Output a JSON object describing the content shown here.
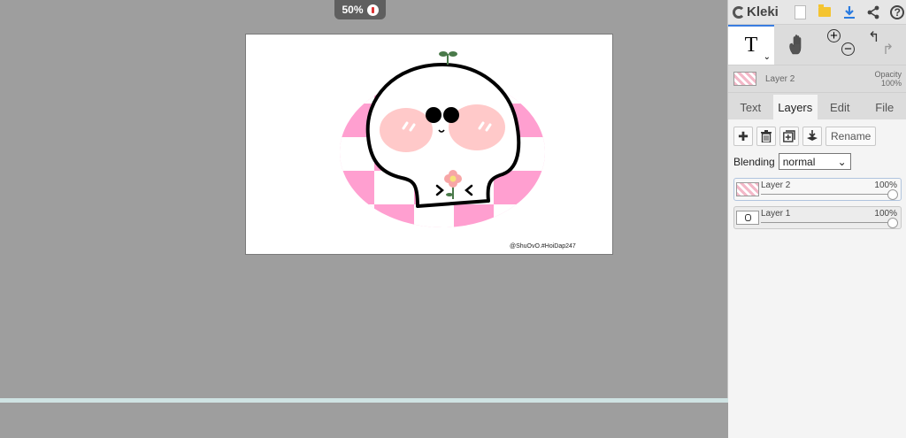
{
  "zoom": {
    "level": "50%"
  },
  "canvas": {
    "watermark": "@ShuOvO.#HoiDap247",
    "face_text": "> <"
  },
  "app": {
    "name": "Kleki"
  },
  "toolbar": {
    "icons": [
      "new-icon",
      "open-icon",
      "download-icon",
      "share-icon",
      "help-icon"
    ],
    "help_label": "?"
  },
  "tools": {
    "text_tool_label": "T",
    "caret": "⌄"
  },
  "current_layer": {
    "name": "Layer 2",
    "opacity_label": "Opacity",
    "opacity_value": "100%"
  },
  "tabs": [
    {
      "label": "Text"
    },
    {
      "label": "Layers",
      "active": true
    },
    {
      "label": "Edit"
    },
    {
      "label": "File"
    }
  ],
  "layers_panel": {
    "rename_label": "Rename",
    "blending_label": "Blending",
    "blending_value": "normal",
    "layers": [
      {
        "name": "Layer 2",
        "opacity": "100%",
        "opacity_fraction": 1.0,
        "active": true
      },
      {
        "name": "Layer 1",
        "opacity": "100%",
        "opacity_fraction": 1.0,
        "active": false
      }
    ]
  },
  "colors": {
    "workspace": "#9e9e9e",
    "pink": "#ff9fd0",
    "cheek": "#ffc9c9",
    "accent": "#3a7de0"
  }
}
